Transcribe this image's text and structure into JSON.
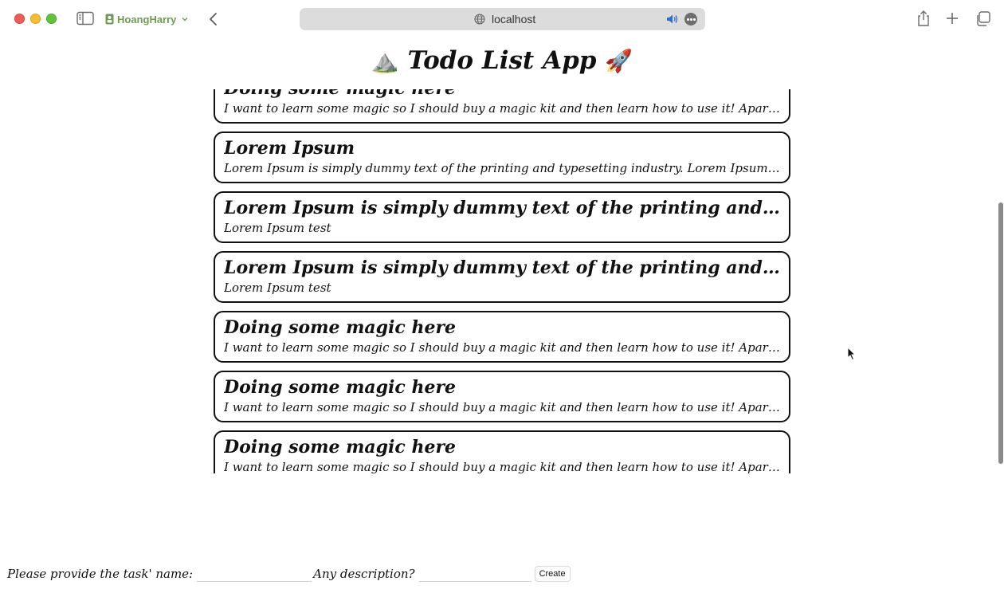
{
  "browser": {
    "profile_name": "HoangHarry",
    "url": "localhost",
    "profile_color": "#6f9a57"
  },
  "app": {
    "title": "Todo List App",
    "title_emoji_left": "⛰️",
    "title_emoji_right": "🚀"
  },
  "todos": [
    {
      "title": "Doing some magic here",
      "description": "I want to learn some magic so I should buy a magic kit and then learn how to use it! Apart from these, I will practice every day."
    },
    {
      "title": "Lorem Ipsum",
      "description": "Lorem Ipsum is simply dummy text of the printing and typesetting industry. Lorem Ipsum has been the industry's standard dummy text."
    },
    {
      "title": "Lorem Ipsum is simply dummy text of the printing and typesetting industry",
      "description": "Lorem Ipsum test"
    },
    {
      "title": "Lorem Ipsum is simply dummy text of the printing and typesetting industry",
      "description": "Lorem Ipsum test"
    },
    {
      "title": "Doing some magic here",
      "description": "I want to learn some magic so I should buy a magic kit and then learn how to use it! Apart from these, I will practice every day."
    },
    {
      "title": "Doing some magic here",
      "description": "I want to learn some magic so I should buy a magic kit and then learn how to use it! Apart from these, I will practice every day."
    },
    {
      "title": "Doing some magic here",
      "description": "I want to learn some magic so I should buy a magic kit and then learn how to use it! Apart from these, I will practice every day."
    }
  ],
  "form": {
    "name_label": "Please provide the task' name:",
    "name_value": "",
    "description_label": "Any description?",
    "description_value": "",
    "create_label": "Create"
  }
}
